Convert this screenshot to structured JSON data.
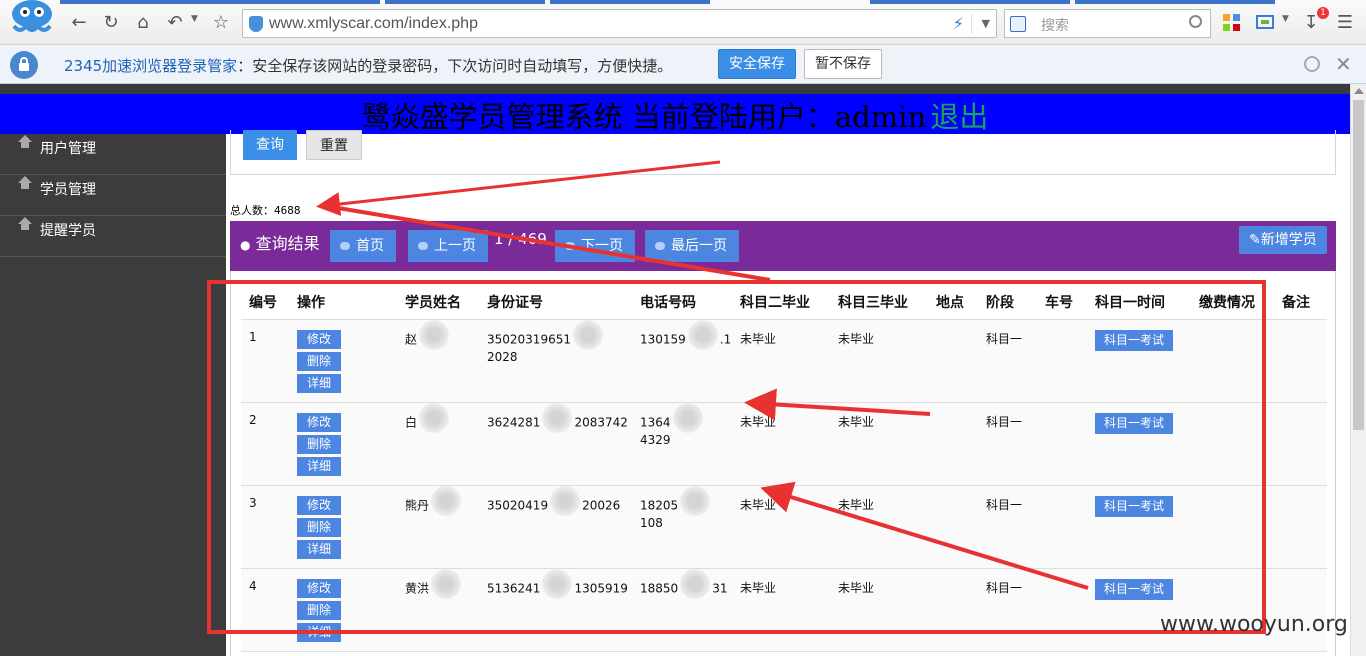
{
  "browser": {
    "url": "www.xmlyscar.com/index.php",
    "search_placeholder": "搜索",
    "download_badge": "1"
  },
  "password_bar": {
    "brand": "2345加速浏览器登录管家",
    "message": "：安全保存该网站的登录密码，下次访问时自动填写，方便快捷。",
    "save_label": "安全保存",
    "nosave_label": "暂不保存"
  },
  "header": {
    "title": "鹭焱盛学员管理系统 当前登陆用户：admin",
    "logout": "退出"
  },
  "sidebar": {
    "items": [
      {
        "label": "用户管理"
      },
      {
        "label": "学员管理"
      },
      {
        "label": "提醒学员"
      }
    ]
  },
  "query": {
    "search_label": "查询",
    "reset_label": "重置"
  },
  "total": "总人数：4688",
  "results": {
    "title": "查询结果",
    "first": "首页",
    "prev": "上一页",
    "page_info": "1 / 469",
    "next": "下一页",
    "last": "最后一页",
    "add": "新增学员"
  },
  "table": {
    "headers": [
      "编号",
      "操作",
      "学员姓名",
      "身份证号",
      "电话号码",
      "科目二毕业",
      "科目三毕业",
      "地点",
      "阶段",
      "车号",
      "科目一时间",
      "缴费情况",
      "备注"
    ],
    "op_buttons": [
      "修改",
      "删除",
      "详细"
    ],
    "exam_label": "科目一考试",
    "rows": [
      {
        "id": "1",
        "name": "赵",
        "idcard_a": "35020319651",
        "idcard_b": "2028",
        "phone_a": "130159",
        "phone_b": ".1",
        "k2": "未毕业",
        "k3": "未毕业",
        "stage": "科目一"
      },
      {
        "id": "2",
        "name": "白",
        "idcard_a": "3624281",
        "idcard_b": "2083742",
        "phone_a": "1364",
        "phone_b": "4329",
        "k2": "未毕业",
        "k3": "未毕业",
        "stage": "科目一"
      },
      {
        "id": "3",
        "name": "熊丹",
        "idcard_a": "35020419",
        "idcard_b": "20026",
        "phone_a": "18205",
        "phone_b": "108",
        "k2": "未毕业",
        "k3": "未毕业",
        "stage": "科目一"
      },
      {
        "id": "4",
        "name": "黄洪",
        "idcard_a": "5136241",
        "idcard_b": "1305919",
        "phone_a": "18850",
        "phone_b": "31",
        "k2": "未毕业",
        "k3": "未毕业",
        "stage": "科目一"
      }
    ]
  },
  "watermark": "www.wooyun.org",
  "colors": {
    "banner": "#0000ff",
    "sidebar": "#3c3c3c",
    "result_bar": "#7a2b99",
    "button_blue": "#4c86e0",
    "annotation_red": "#e83232"
  }
}
